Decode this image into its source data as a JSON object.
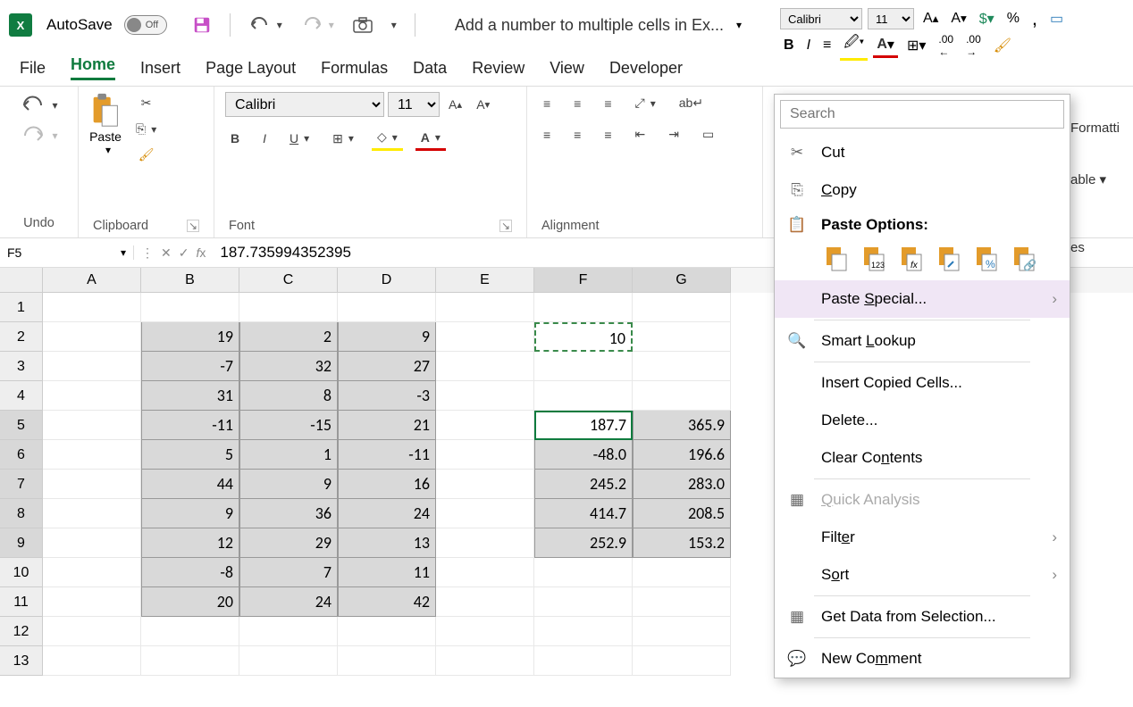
{
  "titlebar": {
    "autosave_label": "AutoSave",
    "autosave_state": "Off",
    "doc_title": "Add a number to multiple cells in Ex..."
  },
  "mini": {
    "font_name": "Calibri",
    "font_size": "11"
  },
  "tabs": [
    "File",
    "Home",
    "Insert",
    "Page Layout",
    "Formulas",
    "Data",
    "Review",
    "View",
    "Developer"
  ],
  "active_tab": "Home",
  "ribbon": {
    "undo_label": "Undo",
    "clipboard_label": "Clipboard",
    "paste_label": "Paste",
    "font_label": "Font",
    "alignment_label": "Alignment",
    "font_name": "Calibri",
    "font_size": "11"
  },
  "right_fragment": {
    "l1": "Formatti",
    "l2": "able ▾",
    "l3": "es"
  },
  "fbar": {
    "namebox": "F5",
    "formula": "187.735994352395"
  },
  "columns": [
    "A",
    "B",
    "C",
    "D",
    "E",
    "F",
    "G"
  ],
  "row_count": 13,
  "cells": {
    "B2": "19",
    "C2": "2",
    "D2": "9",
    "B3": "-7",
    "C3": "32",
    "D3": "27",
    "B4": "31",
    "C4": "8",
    "D4": "-3",
    "B5": "-11",
    "C5": "-15",
    "D5": "21",
    "B6": "5",
    "C6": "1",
    "D6": "-11",
    "B7": "44",
    "C7": "9",
    "D7": "16",
    "B8": "9",
    "C8": "36",
    "D8": "24",
    "B9": "12",
    "C9": "29",
    "D9": "13",
    "B10": "-8",
    "C10": "7",
    "D10": "11",
    "B11": "20",
    "C11": "24",
    "D11": "42",
    "F2": "10",
    "F5": "187.7",
    "G5": "365.9",
    "F6": "-48.0",
    "G6": "196.6",
    "F7": "245.2",
    "G7": "283.0",
    "F8": "414.7",
    "G8": "208.5",
    "F9": "252.9",
    "G9": "153.2"
  },
  "ctx": {
    "search_placeholder": "Search",
    "cut": "Cut",
    "copy": "Copy",
    "paste_options": "Paste Options:",
    "paste_special": "Paste Special...",
    "smart_lookup": "Smart Lookup",
    "insert": "Insert Copied Cells...",
    "delete": "Delete...",
    "clear": "Clear Contents",
    "quick": "Quick Analysis",
    "filter": "Filter",
    "sort": "Sort",
    "get_data": "Get Data from Selection...",
    "comment": "New Comment"
  },
  "chart_data": {
    "type": "table",
    "ranges": {
      "B2:D11": [
        [
          19,
          2,
          9
        ],
        [
          -7,
          32,
          27
        ],
        [
          31,
          8,
          -3
        ],
        [
          -11,
          -15,
          21
        ],
        [
          5,
          1,
          -11
        ],
        [
          44,
          9,
          16
        ],
        [
          9,
          36,
          24
        ],
        [
          12,
          29,
          13
        ],
        [
          -8,
          7,
          11
        ],
        [
          20,
          24,
          42
        ]
      ],
      "F2": 10,
      "F5:G9": [
        [
          187.7,
          365.9
        ],
        [
          -48.0,
          196.6
        ],
        [
          245.2,
          283.0
        ],
        [
          414.7,
          208.5
        ],
        [
          252.9,
          153.2
        ]
      ]
    },
    "active_cell": "F5",
    "copied_cell": "F2"
  }
}
